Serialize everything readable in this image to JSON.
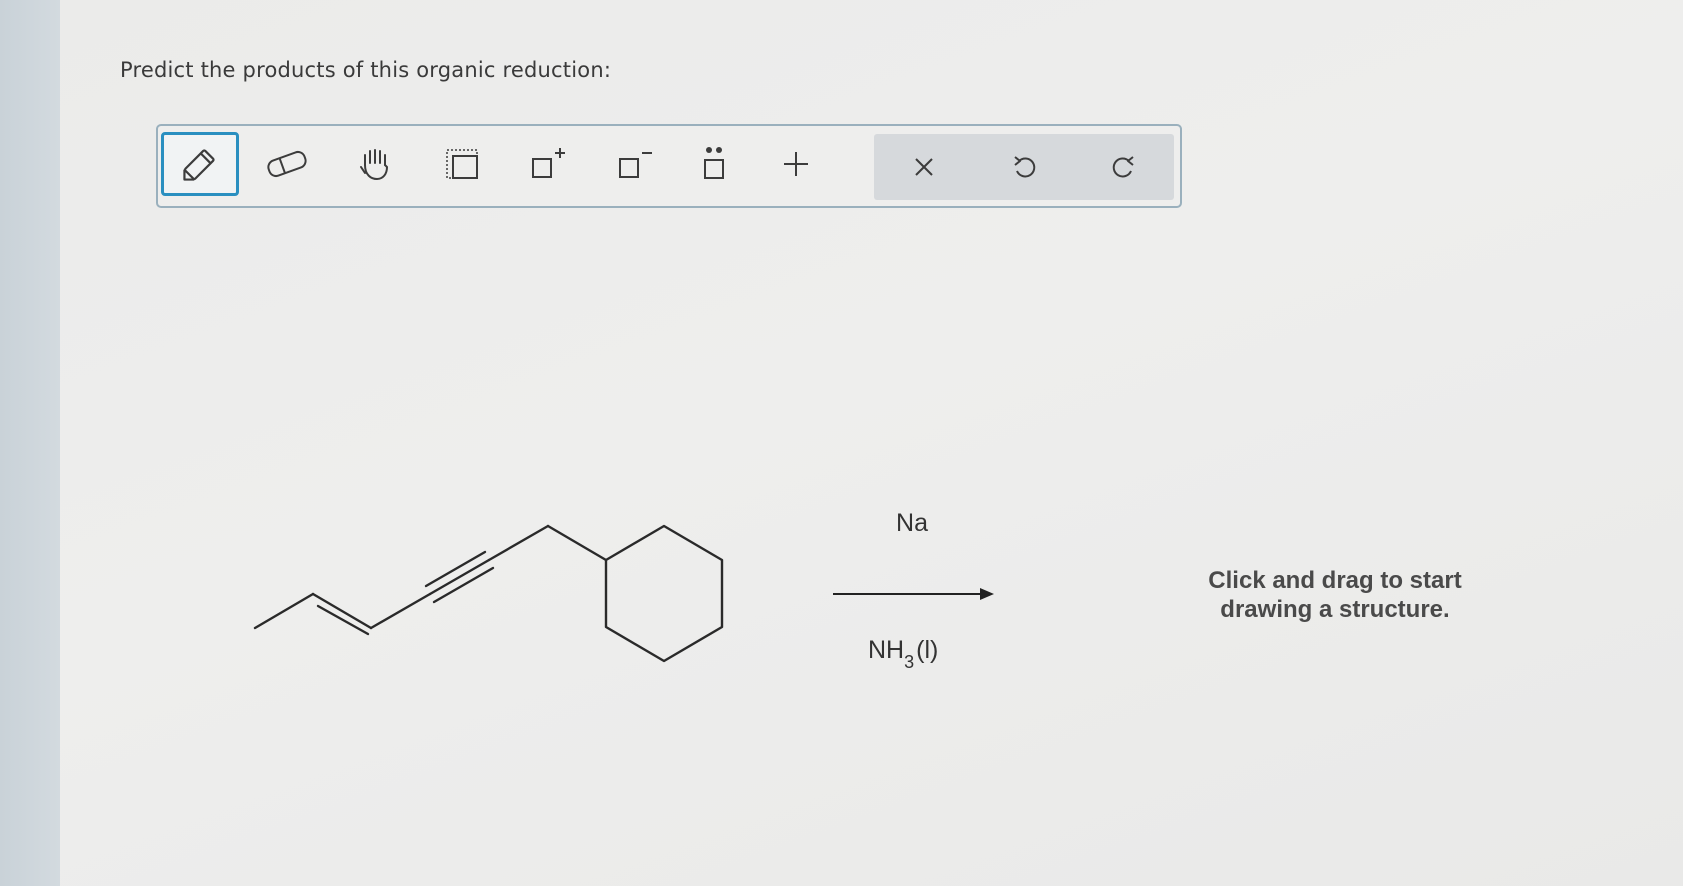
{
  "question": {
    "prompt": "Predict the products of this organic reduction:"
  },
  "toolbar": {
    "tools": [
      {
        "name": "pencil-icon",
        "active": true
      },
      {
        "name": "eraser-icon",
        "active": false
      },
      {
        "name": "hand-icon",
        "active": false
      },
      {
        "name": "select-box-icon",
        "active": false
      },
      {
        "name": "add-positive-charge-icon",
        "active": false
      },
      {
        "name": "add-negative-charge-icon",
        "active": false
      },
      {
        "name": "lone-pair-icon",
        "active": false
      },
      {
        "name": "add-reaction-plus-icon",
        "active": false
      }
    ],
    "actions": [
      {
        "name": "clear-icon"
      },
      {
        "name": "undo-icon"
      },
      {
        "name": "redo-icon"
      }
    ],
    "accent_color": "#2a8fc0",
    "border_color": "#9ab0bd"
  },
  "reaction": {
    "reagent_top": "Na",
    "reagent_bottom_main": "NH",
    "reagent_bottom_sub": "3",
    "reagent_bottom_phase": "(l)"
  },
  "drawing_area": {
    "hint_line1": "Click and drag to start",
    "hint_line2": "drawing a structure."
  }
}
